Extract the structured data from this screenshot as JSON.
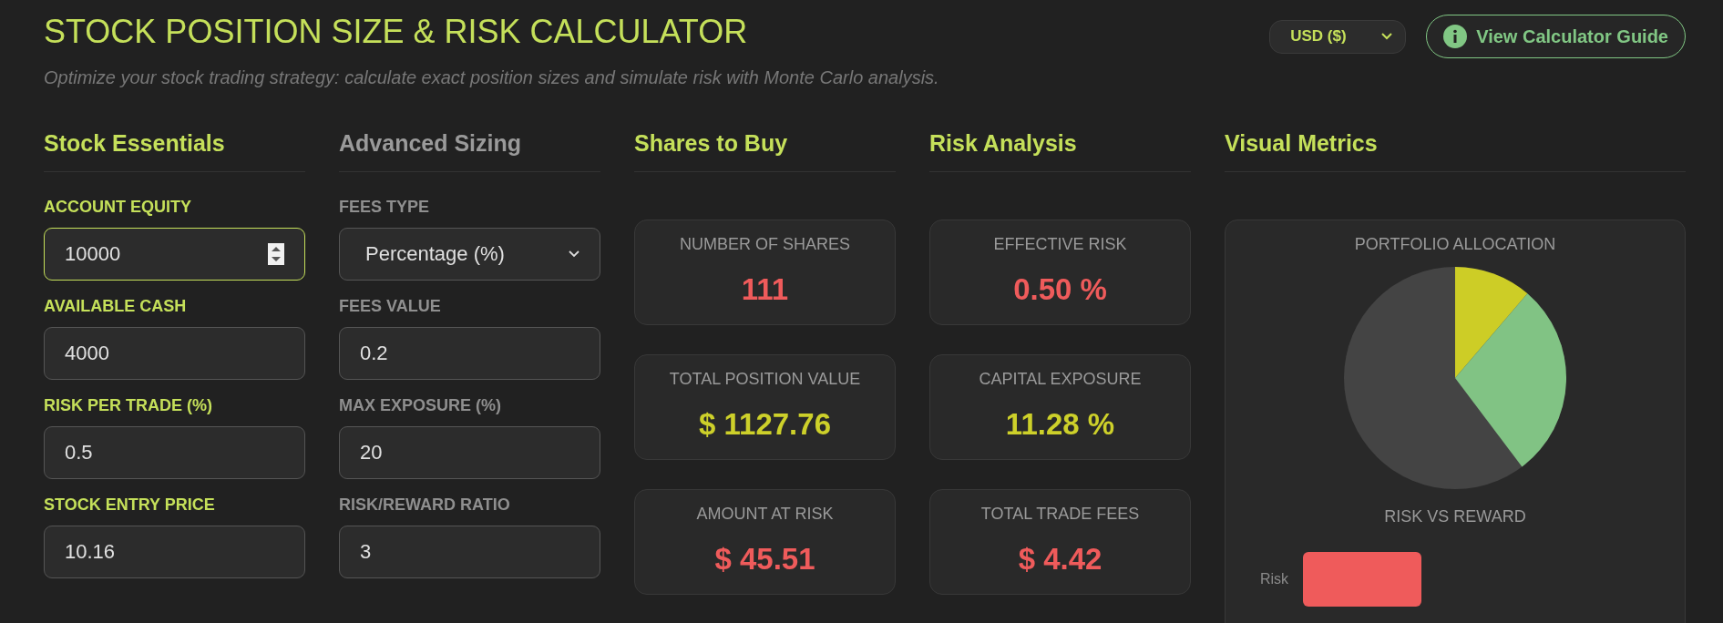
{
  "header": {
    "title": "STOCK POSITION SIZE & RISK CALCULATOR",
    "subtitle": "Optimize your stock trading strategy: calculate exact position sizes and simulate risk with Monte Carlo analysis.",
    "currency": "USD ($)",
    "guide_button": "View Calculator Guide"
  },
  "inputs": [
    {
      "heading": "Stock Essentials",
      "active": true,
      "fields": [
        {
          "label": "ACCOUNT EQUITY",
          "value": "10000",
          "kind": "spinner",
          "focused": true
        },
        {
          "label": "AVAILABLE CASH",
          "value": "4000",
          "kind": "text",
          "focused": false
        },
        {
          "label": "RISK PER TRADE (%)",
          "value": "0.5",
          "kind": "text",
          "focused": false
        },
        {
          "label": "STOCK ENTRY PRICE",
          "value": "10.16",
          "kind": "text",
          "focused": false
        }
      ]
    },
    {
      "heading": "Advanced Sizing",
      "active": false,
      "fields": [
        {
          "label": "FEES TYPE",
          "value": "Percentage (%)",
          "kind": "select",
          "focused": false
        },
        {
          "label": "FEES VALUE",
          "value": "0.2",
          "kind": "text",
          "focused": false
        },
        {
          "label": "MAX EXPOSURE (%)",
          "value": "20",
          "kind": "text",
          "focused": false
        },
        {
          "label": "RISK/REWARD RATIO",
          "value": "3",
          "kind": "text",
          "focused": false
        }
      ]
    }
  ],
  "results": [
    {
      "heading": "Shares to Buy",
      "cards": [
        {
          "label": "NUMBER OF SHARES",
          "value": "111",
          "color": "#ef5b5b"
        },
        {
          "label": "TOTAL POSITION VALUE",
          "value": "$ 1127.76",
          "color": "#cdd02a"
        },
        {
          "label": "AMOUNT AT RISK",
          "value": "$ 45.51",
          "color": "#ef5b5b"
        }
      ]
    },
    {
      "heading": "Risk Analysis",
      "cards": [
        {
          "label": "EFFECTIVE RISK",
          "value": "0.50 %",
          "color": "#ef5b5b"
        },
        {
          "label": "CAPITAL EXPOSURE",
          "value": "11.28 %",
          "color": "#cdd02a"
        },
        {
          "label": "TOTAL TRADE FEES",
          "value": "$ 4.42",
          "color": "#ef5b5b"
        }
      ]
    }
  ],
  "visual": {
    "heading": "Visual Metrics",
    "allocation_title": "PORTFOLIO ALLOCATION",
    "risk_reward_title": "RISK VS REWARD",
    "bar_label": "Risk"
  }
}
